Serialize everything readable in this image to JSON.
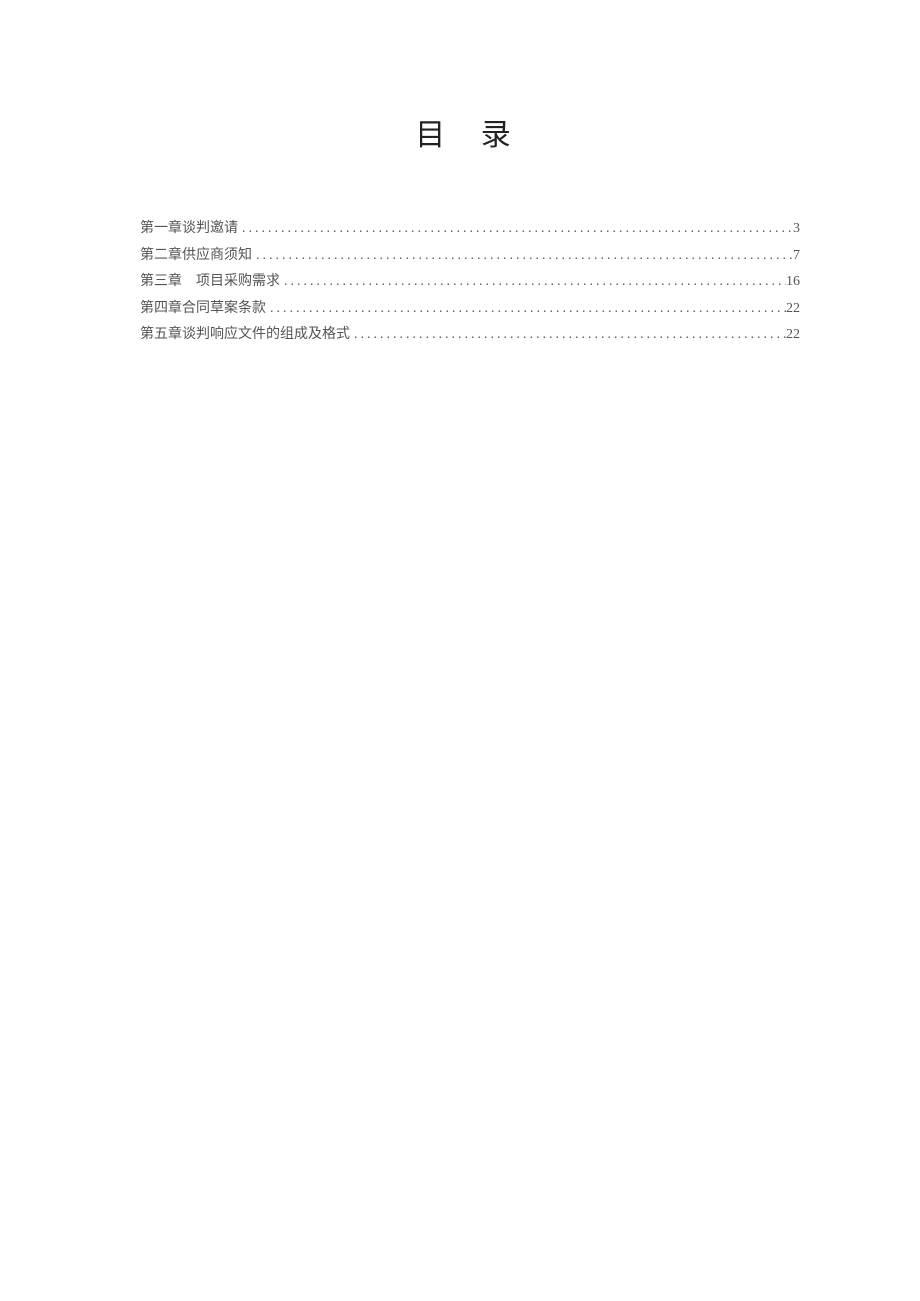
{
  "title": "目 录",
  "toc": {
    "entries": [
      {
        "label": "第一章谈判邀请",
        "page": "3"
      },
      {
        "label": "第二章供应商须知",
        "page": "7"
      },
      {
        "label": "第三章　项目采购需求",
        "page": "16"
      },
      {
        "label": "第四章合同草案条款",
        "page": "22"
      },
      {
        "label": "第五章谈判响应文件的组成及格式",
        "page": "22"
      }
    ]
  }
}
